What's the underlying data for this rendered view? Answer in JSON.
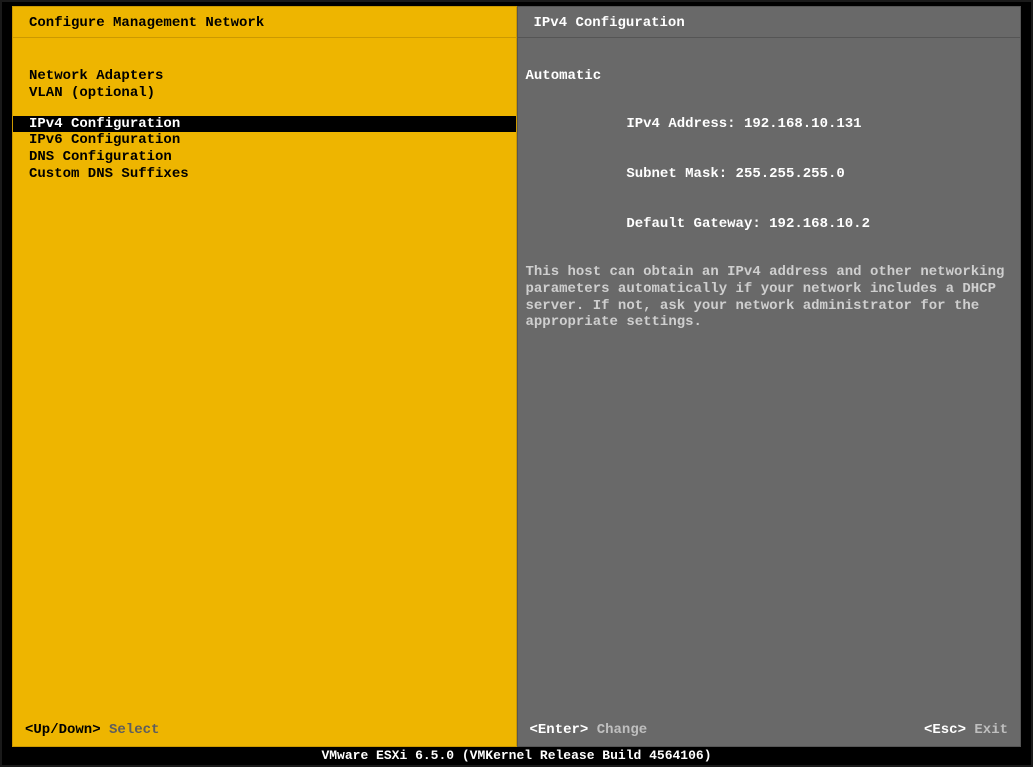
{
  "left": {
    "title": "Configure Management Network",
    "group1": [
      "Network Adapters",
      "VLAN (optional)"
    ],
    "group2": [
      "IPv4 Configuration",
      "IPv6 Configuration",
      "DNS Configuration",
      "Custom DNS Suffixes"
    ],
    "selected": "IPv4 Configuration",
    "footer": {
      "key": "<Up/Down>",
      "label": " Select"
    }
  },
  "right": {
    "title": "IPv4 Configuration",
    "mode": "Automatic",
    "fields": {
      "ipv4_label": "IPv4 Address: ",
      "ipv4_value": "192.168.10.131",
      "mask_label": "Subnet Mask: ",
      "mask_value": "255.255.255.0",
      "gw_label": "Default Gateway: ",
      "gw_value": "192.168.10.2"
    },
    "description": "This host can obtain an IPv4 address and other networking parameters automatically if your network includes a DHCP server. If not, ask your network administrator for the appropriate settings.",
    "footer_left": {
      "key": "<Enter>",
      "label": " Change"
    },
    "footer_right": {
      "key": "<Esc>",
      "label": " Exit"
    }
  },
  "status": "VMware ESXi 6.5.0 (VMKernel Release Build 4564106)"
}
